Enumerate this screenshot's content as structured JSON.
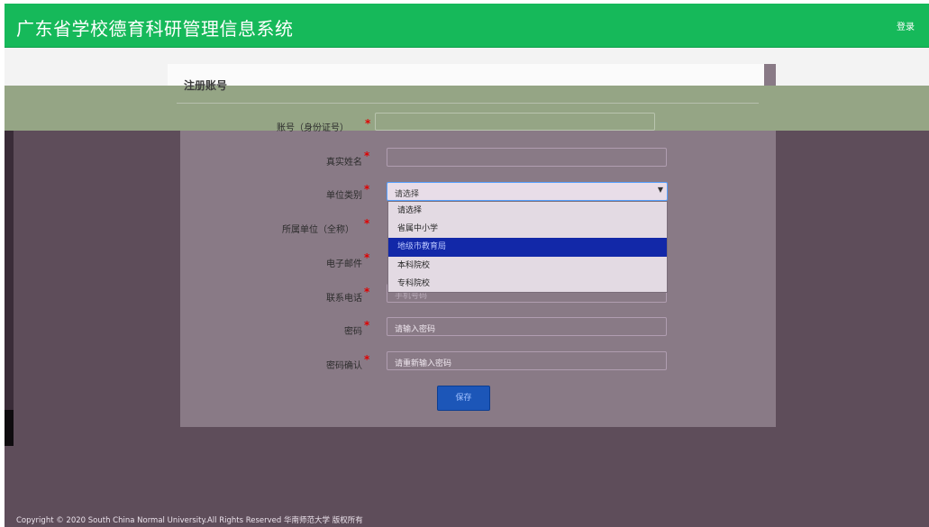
{
  "header": {
    "title": "广东省学校德育科研管理信息系统",
    "login_label": "登录"
  },
  "form": {
    "title": "注册账号",
    "fields": [
      {
        "label": "账号（身份证号）",
        "required_mark": "*",
        "value": "",
        "placeholder": ""
      },
      {
        "label": "真实姓名",
        "required_mark": "*",
        "value": "",
        "placeholder": ""
      },
      {
        "label": "单位类别",
        "required_mark": "*",
        "value": "请选择"
      },
      {
        "label": "所属单位（全称）",
        "required_mark": "*"
      },
      {
        "label": "电子邮件",
        "required_mark": "*"
      },
      {
        "label": "联系电话",
        "required_mark": "*",
        "value": "手机号码"
      },
      {
        "label": "密码",
        "required_mark": "*",
        "placeholder": "请输入密码"
      },
      {
        "label": "密码确认",
        "required_mark": "*",
        "placeholder": "请重新输入密码"
      }
    ],
    "unit_type_options": [
      "请选择",
      "省属中小学",
      "地级市教育局",
      "本科院校",
      "专科院校"
    ],
    "highlighted_option": "地级市教育局",
    "save_label": "保存"
  },
  "footer": {
    "copyright": "Copyright © 2020 South China Normal University.All Rights Reserved 华南师范大学 版权所有"
  },
  "colors": {
    "header_green": "#16b95a",
    "overlay_dark": "#5e4d5a",
    "selection_blue": "#1228a8",
    "required_red": "#e00000"
  }
}
